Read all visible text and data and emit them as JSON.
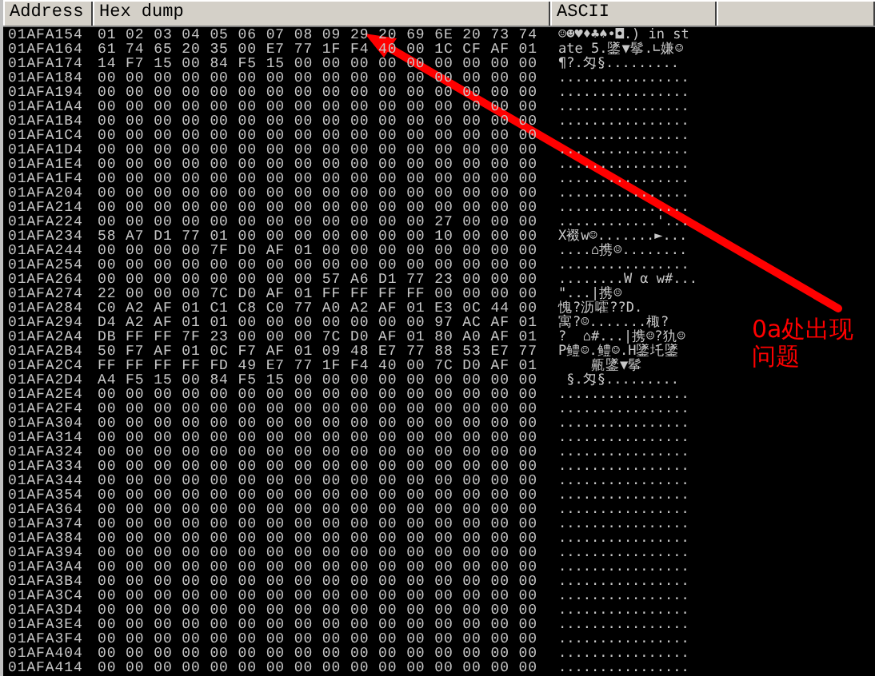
{
  "columns": [
    {
      "label": "Address"
    },
    {
      "label": "Hex dump"
    },
    {
      "label": "ASCII"
    }
  ],
  "rows": [
    {
      "address": "01AFA154",
      "hex": "01 02 03 04 05 06 07 08 09 29 20 69 6E 20 73 74",
      "ascii": "☺☻♥♦♣♠•◘.) in st"
    },
    {
      "address": "01AFA164",
      "hex": "61 74 65 20 35 00 E7 77 1F F4 40 00 1C CF AF 01",
      "ascii": "ate 5.鐆▼鬇.∟嫌☺"
    },
    {
      "address": "01AFA174",
      "hex": "14 F7 15 00 84 F5 15 00 00 00 00 00 00 00 00 00",
      "ascii": "¶?.匁§........."
    },
    {
      "address": "01AFA184",
      "hex": "00 00 00 00 00 00 00 00 00 00 00 00 00 00 00 00",
      "ascii": "................"
    },
    {
      "address": "01AFA194",
      "hex": "00 00 00 00 00 00 00 00 00 00 00 00 00 00 00 00",
      "ascii": "................"
    },
    {
      "address": "01AFA1A4",
      "hex": "00 00 00 00 00 00 00 00 00 00 00 00 00 00 00 00",
      "ascii": "................"
    },
    {
      "address": "01AFA1B4",
      "hex": "00 00 00 00 00 00 00 00 00 00 00 00 00 00 00 00",
      "ascii": "................"
    },
    {
      "address": "01AFA1C4",
      "hex": "00 00 00 00 00 00 00 00 00 00 00 00 00 00 00 00",
      "ascii": "................"
    },
    {
      "address": "01AFA1D4",
      "hex": "00 00 00 00 00 00 00 00 00 00 00 00 00 00 00 00",
      "ascii": "................"
    },
    {
      "address": "01AFA1E4",
      "hex": "00 00 00 00 00 00 00 00 00 00 00 00 00 00 00 00",
      "ascii": "................"
    },
    {
      "address": "01AFA1F4",
      "hex": "00 00 00 00 00 00 00 00 00 00 00 00 00 00 00 00",
      "ascii": "................"
    },
    {
      "address": "01AFA204",
      "hex": "00 00 00 00 00 00 00 00 00 00 00 00 00 00 00 00",
      "ascii": "................"
    },
    {
      "address": "01AFA214",
      "hex": "00 00 00 00 00 00 00 00 00 00 00 00 00 00 00 00",
      "ascii": "................"
    },
    {
      "address": "01AFA224",
      "hex": "00 00 00 00 00 00 00 00 00 00 00 00 27 00 00 00",
      "ascii": "............'..."
    },
    {
      "address": "01AFA234",
      "hex": "58 A7 D1 77 01 00 00 00 00 00 00 00 10 00 00 00",
      "ascii": "X裰w☺.......►..."
    },
    {
      "address": "01AFA244",
      "hex": "00 00 00 00 7F D0 AF 01 00 00 00 00 00 00 00 00",
      "ascii": "....⌂携☺........"
    },
    {
      "address": "01AFA254",
      "hex": "00 00 00 00 00 00 00 00 00 00 00 00 00 00 00 00",
      "ascii": "................"
    },
    {
      "address": "01AFA264",
      "hex": "00 00 00 00 00 00 00 00 57 A6 D1 77 23 00 00 00",
      "ascii": "........W α w#..."
    },
    {
      "address": "01AFA274",
      "hex": "22 00 00 00 7C D0 AF 01 FF FF FF FF 00 00 00 00",
      "ascii": "\"...|携☺"
    },
    {
      "address": "01AFA284",
      "hex": "C0 A2 AF 01 C1 C8 C0 77 A0 A2 AF 01 E3 0C 44 00",
      "ascii": "愧?沥嚯??D."
    },
    {
      "address": "01AFA294",
      "hex": "D4 A2 AF 01 01 00 00 00 00 00 00 00 97 AC AF 01",
      "ascii": "寓?☺.......棷?"
    },
    {
      "address": "01AFA2A4",
      "hex": "DB FF FF 7F 23 00 00 00 7C D0 AF 01 80 A0 AF 01",
      "ascii": "?  ⌂#...|携☺?犰☺"
    },
    {
      "address": "01AFA2B4",
      "hex": "50 F7 AF 01 0C F7 AF 01 09 48 E7 77 88 53 E7 77",
      "ascii": "P鳢☺.鳢☺.H鐆圫鐆"
    },
    {
      "address": "01AFA2C4",
      "hex": "FF FF FF FF FD 49 E7 77 1F F4 40 00 7C D0 AF 01",
      "ascii": "    齀鐆▼鬇"
    },
    {
      "address": "01AFA2D4",
      "hex": "A4 F5 15 00 84 F5 15 00 00 00 00 00 00 00 00 00",
      "ascii": " §.匁§........."
    },
    {
      "address": "01AFA2E4",
      "hex": "00 00 00 00 00 00 00 00 00 00 00 00 00 00 00 00",
      "ascii": "................"
    },
    {
      "address": "01AFA2F4",
      "hex": "00 00 00 00 00 00 00 00 00 00 00 00 00 00 00 00",
      "ascii": "................"
    },
    {
      "address": "01AFA304",
      "hex": "00 00 00 00 00 00 00 00 00 00 00 00 00 00 00 00",
      "ascii": "................"
    },
    {
      "address": "01AFA314",
      "hex": "00 00 00 00 00 00 00 00 00 00 00 00 00 00 00 00",
      "ascii": "................"
    },
    {
      "address": "01AFA324",
      "hex": "00 00 00 00 00 00 00 00 00 00 00 00 00 00 00 00",
      "ascii": "................"
    },
    {
      "address": "01AFA334",
      "hex": "00 00 00 00 00 00 00 00 00 00 00 00 00 00 00 00",
      "ascii": "................"
    },
    {
      "address": "01AFA344",
      "hex": "00 00 00 00 00 00 00 00 00 00 00 00 00 00 00 00",
      "ascii": "................"
    },
    {
      "address": "01AFA354",
      "hex": "00 00 00 00 00 00 00 00 00 00 00 00 00 00 00 00",
      "ascii": "................"
    },
    {
      "address": "01AFA364",
      "hex": "00 00 00 00 00 00 00 00 00 00 00 00 00 00 00 00",
      "ascii": "................"
    },
    {
      "address": "01AFA374",
      "hex": "00 00 00 00 00 00 00 00 00 00 00 00 00 00 00 00",
      "ascii": "................"
    },
    {
      "address": "01AFA384",
      "hex": "00 00 00 00 00 00 00 00 00 00 00 00 00 00 00 00",
      "ascii": "................"
    },
    {
      "address": "01AFA394",
      "hex": "00 00 00 00 00 00 00 00 00 00 00 00 00 00 00 00",
      "ascii": "................"
    },
    {
      "address": "01AFA3A4",
      "hex": "00 00 00 00 00 00 00 00 00 00 00 00 00 00 00 00",
      "ascii": "................"
    },
    {
      "address": "01AFA3B4",
      "hex": "00 00 00 00 00 00 00 00 00 00 00 00 00 00 00 00",
      "ascii": "................"
    },
    {
      "address": "01AFA3C4",
      "hex": "00 00 00 00 00 00 00 00 00 00 00 00 00 00 00 00",
      "ascii": "................"
    },
    {
      "address": "01AFA3D4",
      "hex": "00 00 00 00 00 00 00 00 00 00 00 00 00 00 00 00",
      "ascii": "................"
    },
    {
      "address": "01AFA3E4",
      "hex": "00 00 00 00 00 00 00 00 00 00 00 00 00 00 00 00",
      "ascii": "................"
    },
    {
      "address": "01AFA3F4",
      "hex": "00 00 00 00 00 00 00 00 00 00 00 00 00 00 00 00",
      "ascii": "................"
    },
    {
      "address": "01AFA404",
      "hex": "00 00 00 00 00 00 00 00 00 00 00 00 00 00 00 00",
      "ascii": "................"
    },
    {
      "address": "01AFA414",
      "hex": "00 00 00 00 00 00 00 00 00 00 00 00 00 00 00 00",
      "ascii": "................"
    }
  ],
  "annotation": {
    "text": "0a处出现问题"
  }
}
